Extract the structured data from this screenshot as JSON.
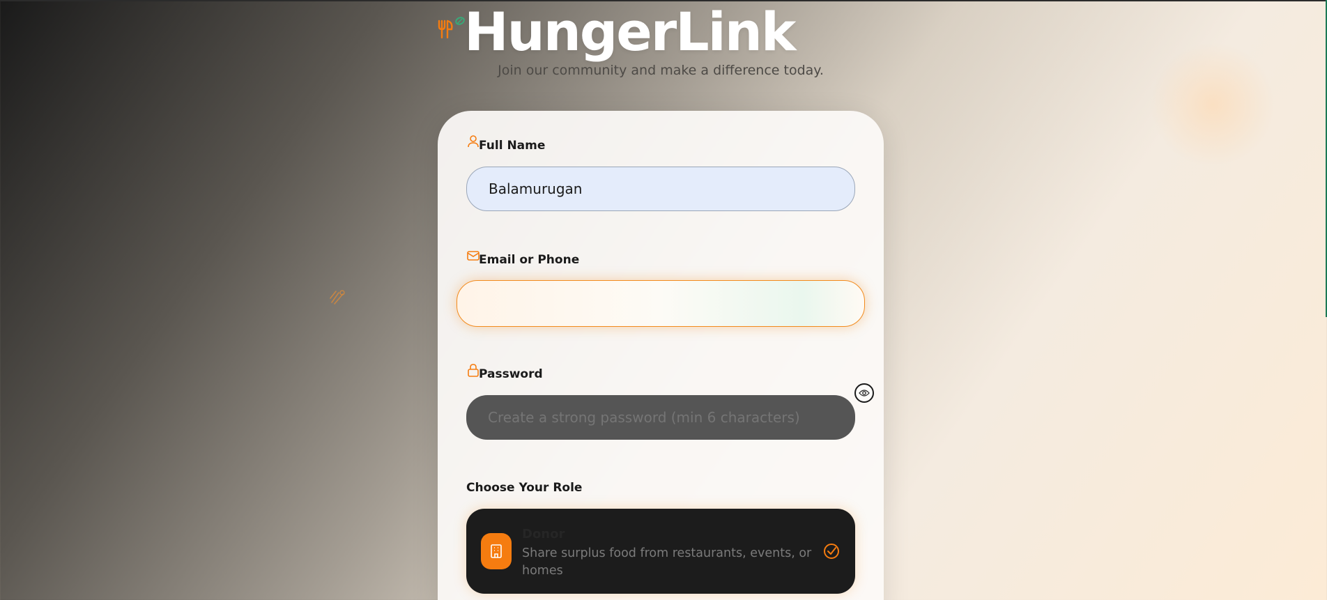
{
  "header": {
    "brand_name": "HungerLink",
    "subtitle": "Join our community and make a difference today."
  },
  "form": {
    "full_name": {
      "label": "Full Name",
      "value": "Balamurugan",
      "icon": "user-icon"
    },
    "email": {
      "label": "Email or Phone",
      "value": "",
      "placeholder": "",
      "icon": "mail-icon"
    },
    "password": {
      "label": "Password",
      "placeholder": "Create a strong password (min 6 characters)",
      "icon": "lock-icon",
      "toggle_icon": "eye-icon"
    },
    "role": {
      "label": "Choose Your Role",
      "selected": {
        "title": "Donor",
        "description": "Share surplus food from restaurants, events, or homes",
        "icon": "building-icon",
        "check_icon": "check-circle-icon"
      }
    }
  },
  "colors": {
    "accent": "#f57c10",
    "leaf": "#3aa878",
    "card_dark": "#1c1c1c"
  }
}
